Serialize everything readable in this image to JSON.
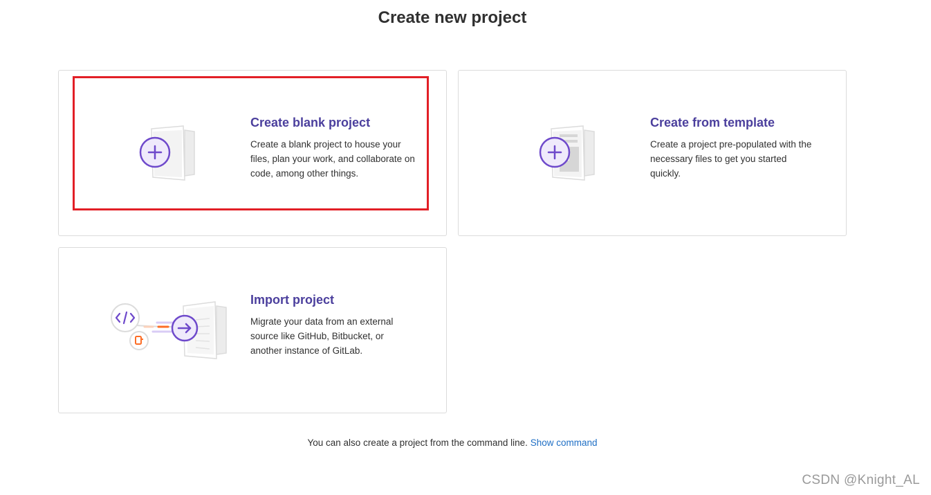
{
  "page": {
    "title": "Create new project"
  },
  "cards": {
    "blank": {
      "heading": "Create blank project",
      "description": "Create a blank project to house your files, plan your work, and collaborate on code, among other things.",
      "icon": "plus-document-icon"
    },
    "template": {
      "heading": "Create from template",
      "description": "Create a project pre-populated with the necessary files to get you started quickly.",
      "icon": "template-document-icon"
    },
    "import": {
      "heading": "Import project",
      "description": "Migrate your data from an external source like GitHub, Bitbucket, or another instance of GitLab.",
      "icon": "import-arrow-icon"
    }
  },
  "footer": {
    "text": "You can also create a project from the command line.",
    "link_label": "Show command"
  },
  "watermark": "CSDN @Knight_AL",
  "colors": {
    "accent": "#4b3f9d",
    "icon_purple": "#6e49cb",
    "highlight": "#e21f26",
    "link": "#1f6fc5"
  }
}
